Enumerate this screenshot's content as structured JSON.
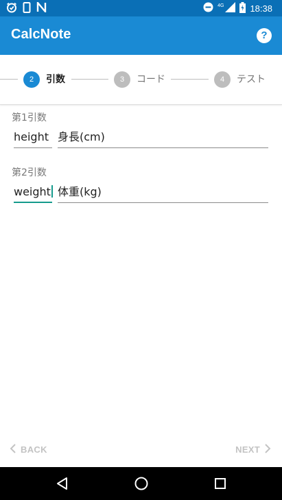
{
  "status_bar": {
    "left_icons": [
      "alarm-icon",
      "phone-icon",
      "notification-n-icon"
    ],
    "network": "4G",
    "time": "18:38"
  },
  "app_bar": {
    "title": "CalcNote",
    "help_icon": "help-circle-icon",
    "help_glyph": "?"
  },
  "stepper": {
    "steps": [
      {
        "number": "2",
        "label": "引数",
        "active": true
      },
      {
        "number": "3",
        "label": "コード",
        "active": false
      },
      {
        "number": "4",
        "label": "テスト",
        "active": false
      }
    ],
    "active_color": "#1a8ad4",
    "inactive_color": "#bdbdbd"
  },
  "arguments": [
    {
      "section_label": "第1引数",
      "name": "height",
      "description": "身長(cm)"
    },
    {
      "section_label": "第2引数",
      "name": "weight",
      "description": "体重(kg)"
    }
  ],
  "bottom_nav": {
    "back_label": "BACK",
    "next_label": "NEXT"
  },
  "colors": {
    "status_bar": "#0a6fb6",
    "app_bar": "#1a8ad4",
    "focus_accent": "#149a8c"
  }
}
